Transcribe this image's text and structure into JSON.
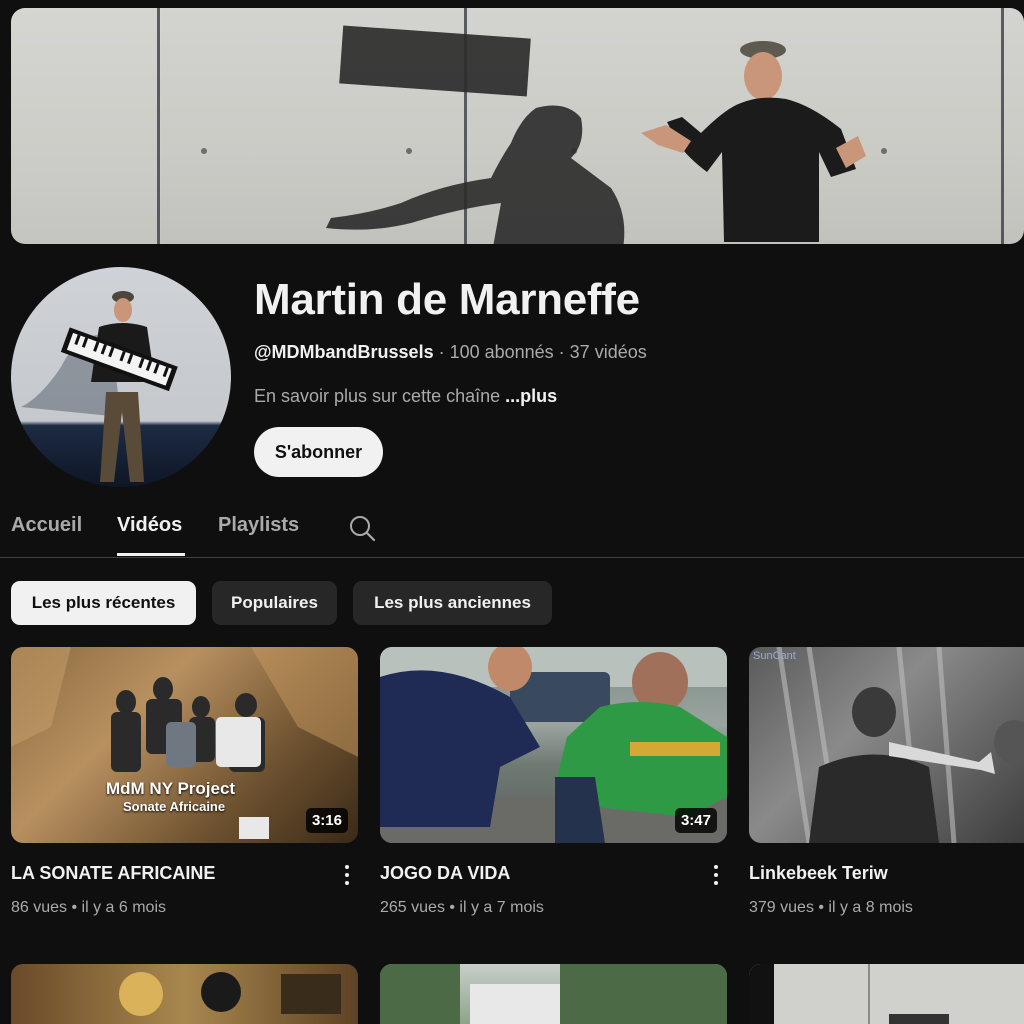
{
  "channel": {
    "name": "Martin de Marneffe",
    "handle": "@MDMbandBrussels",
    "stats": " · 100 abonnés · 37 vidéos",
    "about_text": "En savoir plus sur cette chaîne ",
    "about_more": "...plus",
    "subscribe_label": "S'abonner"
  },
  "tabs": [
    {
      "label": "Accueil",
      "active": false
    },
    {
      "label": "Vidéos",
      "active": true
    },
    {
      "label": "Playlists",
      "active": false
    }
  ],
  "chips": [
    {
      "label": "Les plus récentes",
      "active": true
    },
    {
      "label": "Populaires",
      "active": false
    },
    {
      "label": "Les plus anciennes",
      "active": false
    }
  ],
  "videos": [
    {
      "title": "LA SONATE AFRICAINE",
      "meta": "86 vues • il y a 6 mois",
      "duration": "3:16",
      "overlay_line1": "MdM NY Project",
      "overlay_line2": "Sonate Africaine"
    },
    {
      "title": "JOGO DA VIDA",
      "meta": "265 vues • il y a 7 mois",
      "duration": "3:47"
    },
    {
      "title": "Linkebeek Teriw",
      "meta": "379 vues • il y a 8 mois",
      "duration": "",
      "watermark": "SunCant"
    }
  ],
  "icons": {
    "search": "search-icon",
    "more": "more-vert-icon"
  },
  "colors": {
    "background": "#0f0f0f",
    "text_primary": "#f1f1f1",
    "text_secondary": "#aaaaaa",
    "chip_bg": "#272727",
    "chip_active_bg": "#f1f1f1"
  }
}
